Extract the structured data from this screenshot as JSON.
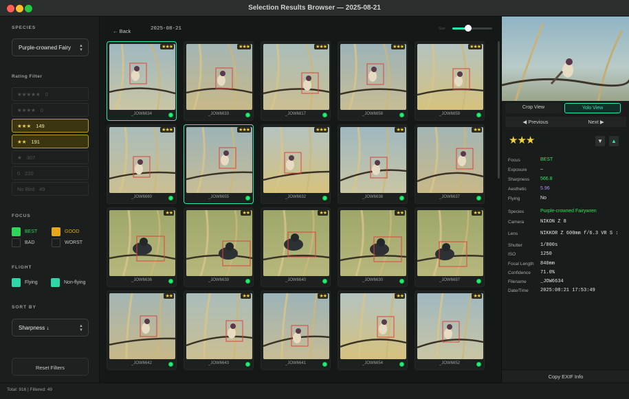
{
  "window": {
    "title": "Selection Results Browser — 2025-08-21"
  },
  "sidebar": {
    "species_label": "SPECIES",
    "species_value": "Purple-crowned Fairy",
    "rating_label": "Rating Filter",
    "ratings": [
      {
        "stars": "★★★★★",
        "count": "0",
        "active": false
      },
      {
        "stars": "★★★★",
        "count": "0",
        "active": false
      },
      {
        "stars": "★★★",
        "count": "149",
        "active": true
      },
      {
        "stars": "★★",
        "count": "191",
        "active": true
      },
      {
        "stars": "★",
        "count": "307",
        "active": false
      },
      {
        "stars": "0",
        "count": "220",
        "active": false
      },
      {
        "stars": "No Bird",
        "count": "49",
        "active": false
      }
    ],
    "focus_label": "FOCUS",
    "focus": [
      {
        "label": "BEST",
        "color": "#2ed65a",
        "checked": true
      },
      {
        "label": "GOOD",
        "color": "#e6a817",
        "checked": true
      },
      {
        "label": "BAD",
        "color": "",
        "checked": false
      },
      {
        "label": "WORST",
        "color": "",
        "checked": false
      }
    ],
    "flight_label": "FLIGHT",
    "flight": [
      {
        "label": "Flying",
        "color": "#2ed6a8",
        "checked": true
      },
      {
        "label": "Non-flying",
        "color": "#2ed6a8",
        "checked": true
      }
    ],
    "sort_label": "SORT BY",
    "sort_value": "Sharpness ↓",
    "reset_label": "Reset Filters"
  },
  "toolbar": {
    "back_label": "← Back",
    "date": "2025-08-21",
    "size_label": "Size",
    "slider_value": 0.4
  },
  "grid": {
    "items": [
      {
        "name": "_JOW6634",
        "stars": "★★★",
        "selected": true
      },
      {
        "name": "_JOW6633",
        "stars": "★★★",
        "selected": false
      },
      {
        "name": "_JOW6817",
        "stars": "★★★",
        "selected": false
      },
      {
        "name": "_JOW6658",
        "stars": "★★★",
        "selected": false
      },
      {
        "name": "_JOW6659",
        "stars": "★★★",
        "selected": false
      },
      {
        "name": "_JOW6660",
        "stars": "★★★",
        "selected": false
      },
      {
        "name": "_JOW6655",
        "stars": "★★★",
        "selected": true
      },
      {
        "name": "_JOW6632",
        "stars": "★★★",
        "selected": false
      },
      {
        "name": "_JOW6638",
        "stars": "★★",
        "selected": false
      },
      {
        "name": "_JOW6637",
        "stars": "★★",
        "selected": false
      },
      {
        "name": "_JOW6636",
        "stars": "★★",
        "selected": false
      },
      {
        "name": "_JOW6639",
        "stars": "★★",
        "selected": false
      },
      {
        "name": "_JOW6640",
        "stars": "★★",
        "selected": false
      },
      {
        "name": "_JOW6630",
        "stars": "★★",
        "selected": false
      },
      {
        "name": "_JOW6697",
        "stars": "★★",
        "selected": false
      },
      {
        "name": "_JOW6642",
        "stars": "★★",
        "selected": false
      },
      {
        "name": "_JOW6643",
        "stars": "★★",
        "selected": false
      },
      {
        "name": "_JOW6641",
        "stars": "★★",
        "selected": false
      },
      {
        "name": "_JOW6654",
        "stars": "★★",
        "selected": false
      },
      {
        "name": "_JOW6652",
        "stars": "★★",
        "selected": false
      }
    ]
  },
  "detail": {
    "crop_view": "Crop View",
    "yolo_view": "Yolo View",
    "prev": "◀  Previous",
    "next": "Next  ▶",
    "stars": "★★★",
    "fields": [
      {
        "k": "Focus",
        "v": "BEST",
        "color": "#2ee65a",
        "mono": false
      },
      {
        "k": "Exposure",
        "v": "–",
        "color": "#e4e7e5",
        "mono": false
      },
      {
        "k": "Sharpness",
        "v": "566.8",
        "color": "#2ee65a",
        "mono": false
      },
      {
        "k": "Aesthetic",
        "v": "5.96",
        "color": "#a78bfa",
        "mono": false
      },
      {
        "k": "Flying",
        "v": "No",
        "color": "#e4e7e5",
        "mono": false
      },
      {
        "k": "Species",
        "v": "Purple-crowned Fairywren",
        "color": "#2ee65a",
        "mono": false
      },
      {
        "k": "Camera",
        "v": "NIKON Z 8",
        "color": "#e4e7e5",
        "mono": true
      },
      {
        "k": "Lens",
        "v": "NIKKOR Z 600mm f/6.3 VR S :",
        "color": "#e4e7e5",
        "mono": true
      },
      {
        "k": "Shutter",
        "v": "1/800s",
        "color": "#e4e7e5",
        "mono": true
      },
      {
        "k": "ISO",
        "v": "1250",
        "color": "#e4e7e5",
        "mono": true
      },
      {
        "k": "Focal Length",
        "v": "840mm",
        "color": "#e4e7e5",
        "mono": true
      },
      {
        "k": "Confidence",
        "v": "71.0%",
        "color": "#e4e7e5",
        "mono": true
      },
      {
        "k": "Filename",
        "v": "_JOW6634",
        "color": "#e4e7e5",
        "mono": true
      },
      {
        "k": "Date/Time",
        "v": "2025:08:21 17:53:49",
        "color": "#e4e7e5",
        "mono": true
      }
    ],
    "copy_label": "Copy EXIF Info"
  },
  "status": {
    "text": "Total: 916  |  Filtered: 49"
  }
}
